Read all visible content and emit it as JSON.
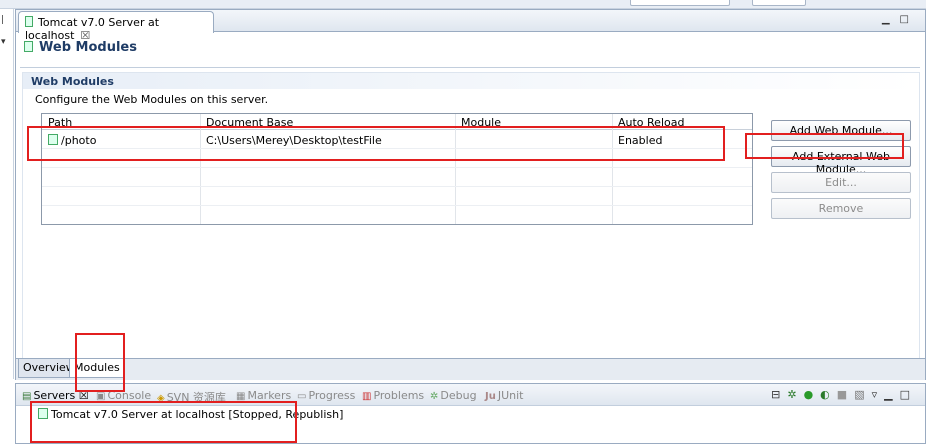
{
  "editor": {
    "tab_title": "Tomcat v7.0 Server at localhost",
    "close_glyph": "☒",
    "header_title": "Web Modules"
  },
  "section": {
    "title": "Web Modules",
    "description": "Configure the Web Modules on this server."
  },
  "table": {
    "columns": [
      "Path",
      "Document Base",
      "Module",
      "Auto Reload"
    ],
    "rows": [
      {
        "path": "/photo",
        "document_base": "C:\\Users\\Merey\\Desktop\\testFile",
        "module": "",
        "auto_reload": "Enabled"
      }
    ]
  },
  "buttons": {
    "add_web_module": "Add Web Module...",
    "add_external_web_module": "Add External Web Module...",
    "edit": "Edit...",
    "remove": "Remove"
  },
  "page_tabs": [
    "Overview",
    "Modules"
  ],
  "servers_view": {
    "tabs": [
      "Servers",
      "Console",
      "SVN 资源库",
      "Markers",
      "Progress",
      "Problems",
      "Debug",
      "JUnit"
    ],
    "server_entry": "Tomcat v7.0 Server at localhost  [Stopped, Republish]"
  },
  "colors": {
    "header_blue": "#1f3c66",
    "annotation_red": "#e21f1f"
  }
}
